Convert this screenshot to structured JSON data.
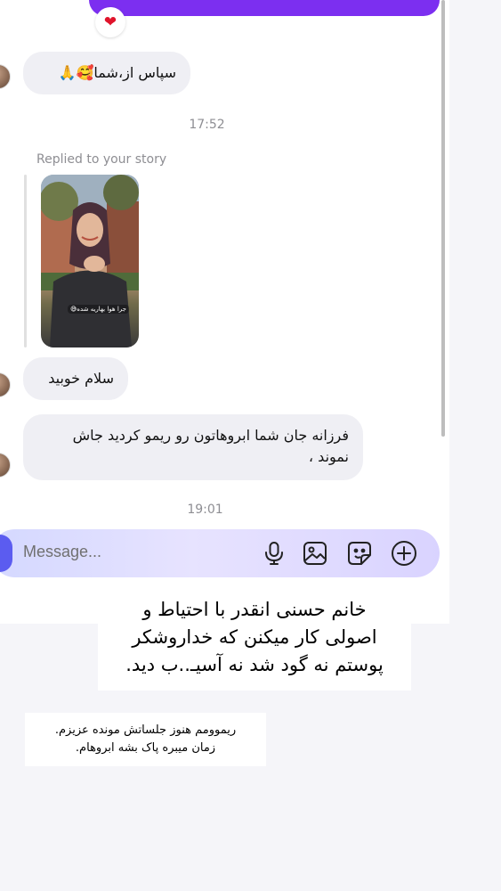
{
  "voice_message": {
    "reaction": "❤"
  },
  "messages": [
    {
      "text": "سپاس از،شما🥰🙏"
    },
    {
      "text": "سلام خوبید"
    },
    {
      "text": "فرزانه جان شما ابروهاتون رو ریمو کردید جاش نموند ،"
    }
  ],
  "timestamps": [
    "17:52",
    "19:01"
  ],
  "story_reply": {
    "label": "Replied to your story",
    "caption": "جرا هوا بهاریه شده😅"
  },
  "composer": {
    "placeholder": "Message...",
    "icons": [
      "camera-icon",
      "microphone-icon",
      "gallery-icon",
      "sticker-icon",
      "add-icon"
    ]
  },
  "overlay_notes": {
    "note1": [
      "خانم حسنی انقدر با احتیاط و",
      "اصولی کار میکنن که خداروشکر",
      "پوستم نه گود شد نه آسیـ..ب دید."
    ],
    "note2": [
      "ریموومم هنوز جلساتش مونده عزیزم.",
      "زمان میبره پاک بشه ابروهام."
    ]
  },
  "colors": {
    "accent": "#7c2ff0",
    "bubble": "#efeff4",
    "composer": "#d9d8ff"
  }
}
